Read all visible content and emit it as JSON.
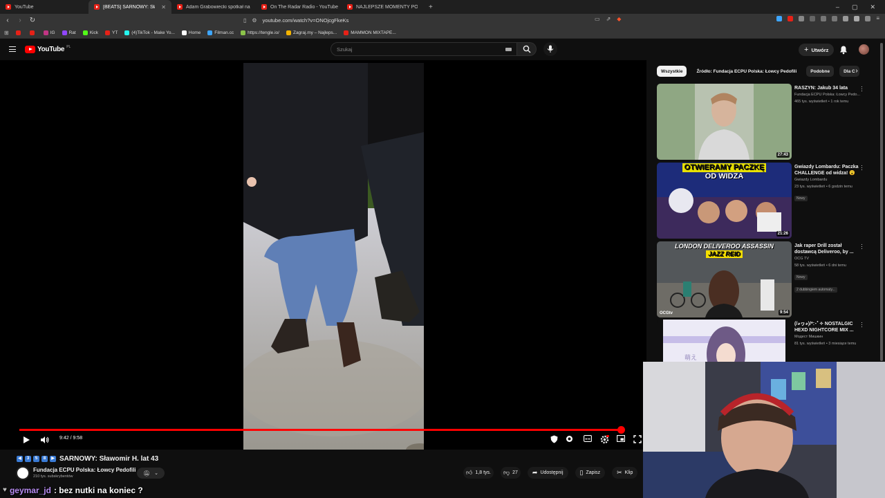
{
  "browser": {
    "tabs": [
      {
        "label": "YouTube",
        "active": false
      },
      {
        "label": "[BEATS] SARNOWY: Sławo...",
        "active": true
      },
      {
        "label": "Adam Grabowiecki spotkał na anon...",
        "active": false
      },
      {
        "label": "On The Radar Radio - YouTube",
        "active": false
      },
      {
        "label": "NAJLEPSZE MOMENTY POLSKIEGO ...",
        "active": false
      }
    ],
    "url": "youtube.com/watch?v=ONOjcgFkeKs",
    "bookmarks": [
      {
        "label": "",
        "color": "#e62117"
      },
      {
        "label": "",
        "color": "#e62117"
      },
      {
        "label": "IG",
        "color": "#c13584"
      },
      {
        "label": "Rat",
        "color": "#9146ff"
      },
      {
        "label": "Kick",
        "color": "#53fc18"
      },
      {
        "label": "YT",
        "color": "#e62117"
      },
      {
        "label": "(4)TikTok - Make Yo...",
        "color": "#25f4ee"
      },
      {
        "label": "Home",
        "color": "#ffffff"
      },
      {
        "label": "Filman.cc",
        "color": "#3ea6ff"
      },
      {
        "label": "https://tengle.io/",
        "color": "#8bc34a"
      },
      {
        "label": "Zagraj.my – Najleps...",
        "color": "#f4b400"
      },
      {
        "label": "MAMMON MIXTAPE...",
        "color": "#e62117"
      }
    ]
  },
  "masthead": {
    "logo_text": "YouTube",
    "region": "PL",
    "search_placeholder": "Szukaj",
    "create_label": "Utwórz"
  },
  "player": {
    "time": "9:42 / 9:58",
    "progress": 0.972
  },
  "video": {
    "title": "SARNOWY: Sławomir H. lat 43",
    "title_badges": [
      "3",
      "5",
      "8"
    ],
    "channel": "Fundacja ECPU Polska: Łowcy Pedofili",
    "subscribers": "210 tys. subskrybentów",
    "likes": "1,8 tys.",
    "dislikes": "27",
    "share_label": "Udostępnij",
    "save_label": "Zapisz",
    "clip_label": "Klip"
  },
  "chat": {
    "user": "geymar_jd",
    "message": ": bez nutki na koniec ?"
  },
  "sidebar": {
    "chips": [
      {
        "label": "Wszystkie",
        "active": true
      },
      {
        "label": "Źródło: Fundacja ECPU Polska: Łowcy Pedofili",
        "active": false
      },
      {
        "label": "Podobne",
        "active": false
      },
      {
        "label": "Dla C",
        "active": false
      }
    ],
    "recommendations": [
      {
        "title": "RASZYN: Jakub 34 lata",
        "channel": "Fundacja ECPU Polska: Łowcy Pedo...",
        "stats": "465 tys. wyświetleń • 1 rok temu",
        "duration": "27:43",
        "badge": "",
        "thumb_text": ""
      },
      {
        "title": "Gwiazdy Lombardu: Paczka CHALLENGE od widza! 😮",
        "channel": "Gwiazdy Lombardu",
        "stats": "23 tys. wyświetleń • 6 godzin temu",
        "duration": "21:26",
        "badge": "Nowy",
        "thumb_text": "OTWIERAMY PACZKĘ OD WIDZA"
      },
      {
        "title": "Jak raper Drill został dostawcą Deliveroo, by ...",
        "channel": "OCG TV",
        "stats": "58 tys. wyświetleń • 6 dni temu",
        "duration": "9:54",
        "badge": "Nowy",
        "badge2": "2 dubbingiem automaty...",
        "thumb_text": "LONDON DELIVEROO ASSASSIN",
        "thumb_text2": "JAZZ REID",
        "thumb_logo": "OCGtv"
      },
      {
        "title": "(/◕ヮ◕)/*:･ﾟ✧ NOSTALGIC HEXD NIGHTCORE MIX ...",
        "channel": "Модест Мишкин",
        "stats": "81 tys. wyświetleń • 3 miesiące temu",
        "duration": "",
        "badge": "",
        "thumb_text": "萌え"
      }
    ]
  },
  "colors": {
    "accent": "#ff0000",
    "background": "#0f0f0f",
    "chat_user": "#b88cf2"
  }
}
